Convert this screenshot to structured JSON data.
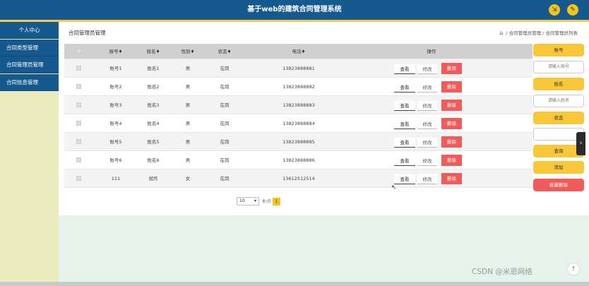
{
  "header": {
    "title": "基于web的建筑合同管理系统",
    "icon_left": "⇲",
    "icon_right": "✎"
  },
  "sidebar": {
    "items": [
      {
        "label": "个人中心"
      },
      {
        "label": "合同类型管理"
      },
      {
        "label": "合同管理员管理"
      },
      {
        "label": "合同信息管理"
      }
    ]
  },
  "page": {
    "title": "合同管理员管理",
    "breadcrumb": [
      "合同管理员管理",
      "合同管理员列表"
    ]
  },
  "table": {
    "columns": {
      "account": "账号",
      "name": "姓名",
      "sex": "性别",
      "status": "状态",
      "phone": "电话",
      "ops": "操作"
    },
    "view_label": "查看",
    "edit_label": "修改",
    "delete_label": "删除",
    "rows": [
      {
        "account": "账号1",
        "name": "姓名1",
        "sex": "男",
        "status": "在岗",
        "phone": "13823888881"
      },
      {
        "account": "账号2",
        "name": "姓名2",
        "sex": "男",
        "status": "在岗",
        "phone": "13823888882"
      },
      {
        "account": "账号3",
        "name": "姓名3",
        "sex": "男",
        "status": "在岗",
        "phone": "13823888883"
      },
      {
        "account": "账号4",
        "name": "姓名4",
        "sex": "男",
        "status": "在岗",
        "phone": "13823888884"
      },
      {
        "account": "账号5",
        "name": "姓名5",
        "sex": "男",
        "status": "在岗",
        "phone": "13823888885"
      },
      {
        "account": "账号6",
        "name": "姓名6",
        "sex": "男",
        "status": "在岗",
        "phone": "13823888886"
      },
      {
        "account": "111",
        "name": "胡月",
        "sex": "女",
        "status": "在岗",
        "phone": "13612512514"
      }
    ]
  },
  "pager": {
    "page_size": "10",
    "per_page_label": "条/页",
    "current_page": "1"
  },
  "filter": {
    "account_label": "账号",
    "account_placeholder": "请输入账号",
    "name_label": "姓名",
    "name_placeholder": "请输入姓名",
    "status_label": "状态",
    "status_value": "",
    "query_label": "查询",
    "add_label": "添加",
    "batch_delete_label": "批量删除"
  },
  "colors": {
    "header": "#15598f",
    "accent": "#f8c83a",
    "danger": "#f35b5b",
    "sidebar_bg": "#ecebc0",
    "page_bg": "#e6f2ec"
  },
  "watermark": "CSDN @米恩网络"
}
